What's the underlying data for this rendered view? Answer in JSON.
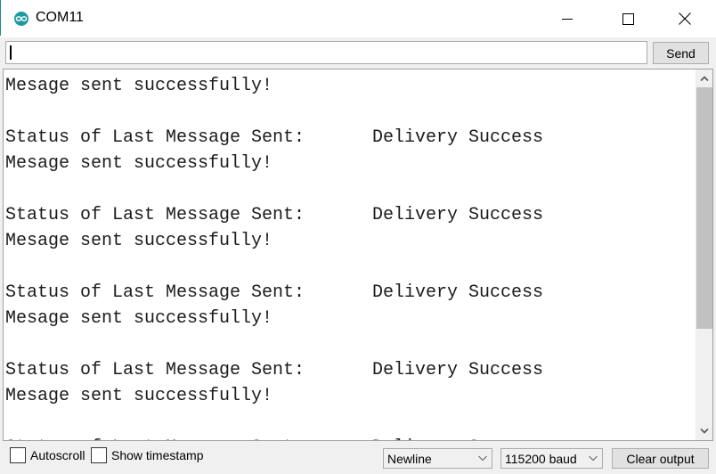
{
  "window": {
    "title": "COM11",
    "app_icon": "arduino-infinity-icon",
    "controls": [
      "minimize-icon",
      "maximize-icon",
      "close-icon"
    ]
  },
  "send_bar": {
    "input_value": "",
    "input_placeholder": "",
    "send_label": "Send"
  },
  "output": {
    "lines": [
      {
        "text": "Mesage sent successfully!",
        "col2": ""
      },
      {
        "text": "",
        "col2": ""
      },
      {
        "text": "Status of Last Message Sent:",
        "col2": "Delivery Success"
      },
      {
        "text": "Mesage sent successfully!",
        "col2": ""
      },
      {
        "text": "",
        "col2": ""
      },
      {
        "text": "Status of Last Message Sent:",
        "col2": "Delivery Success"
      },
      {
        "text": "Mesage sent successfully!",
        "col2": ""
      },
      {
        "text": "",
        "col2": ""
      },
      {
        "text": "Status of Last Message Sent:",
        "col2": "Delivery Success"
      },
      {
        "text": "Mesage sent successfully!",
        "col2": ""
      },
      {
        "text": "",
        "col2": ""
      },
      {
        "text": "Status of Last Message Sent:",
        "col2": "Delivery Success"
      },
      {
        "text": "Mesage sent successfully!",
        "col2": ""
      },
      {
        "text": "",
        "col2": ""
      },
      {
        "text": "Status of Last Message Sent:",
        "col2": "Delivery Success"
      }
    ],
    "scrollbar": {
      "visible_fraction": 0.72,
      "scroll_position": 0.0
    }
  },
  "footer": {
    "autoscroll_label": "Autoscroll",
    "autoscroll_checked": false,
    "timestamp_label": "Show timestamp",
    "timestamp_checked": false,
    "line_ending_selected": "Newline",
    "baud_rate_selected": "115200 baud",
    "clear_label": "Clear output"
  },
  "colors": {
    "app_icon": "#1f9aa3",
    "scroll_thumb": "#c1c1c1",
    "button_bg": "#e1e1e1"
  }
}
